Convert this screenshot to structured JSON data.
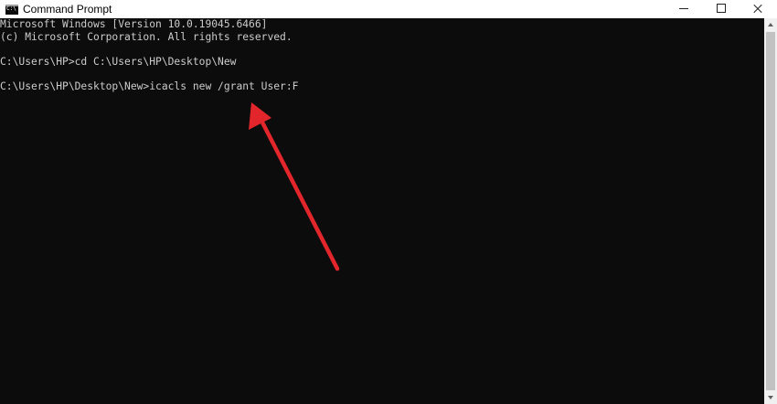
{
  "window": {
    "title": "Command Prompt",
    "icon": "cmd-icon",
    "icon_glyph": "C:\\",
    "controls": [
      "minimize-icon",
      "maximize-icon",
      "close-icon"
    ]
  },
  "console": {
    "lines": [
      "Microsoft Windows [Version 10.0.19045.6466]",
      "(c) Microsoft Corporation. All rights reserved.",
      "",
      "C:\\Users\\HP>cd C:\\Users\\HP\\Desktop\\New",
      "",
      "C:\\Users\\HP\\Desktop\\New>icacls new /grant User:F"
    ],
    "text_color": "#cccccc",
    "background_color": "#0c0c0c"
  },
  "annotation": {
    "type": "arrow",
    "color": "#e3262b",
    "points_to": "/grant User:F"
  }
}
